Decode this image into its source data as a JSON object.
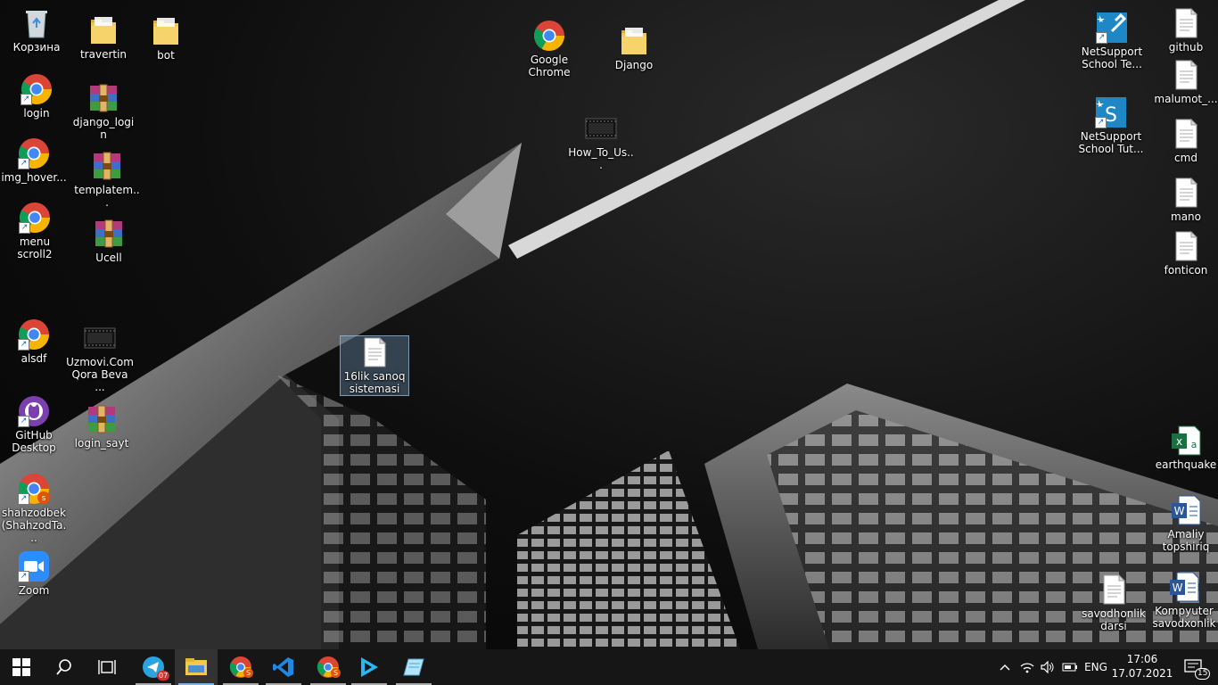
{
  "desktop": {
    "left_icons": [
      {
        "label": "Корзина",
        "icon": "recycle-bin"
      },
      {
        "label": "login",
        "icon": "chrome"
      },
      {
        "label": "img_hover...",
        "icon": "chrome"
      },
      {
        "label": "menu scroll2",
        "icon": "chrome"
      },
      {
        "label": "alsdf",
        "icon": "chrome"
      },
      {
        "label": "GitHub Desktop",
        "icon": "github-desktop"
      },
      {
        "label": "shahzodbek (ShahzodTa...",
        "icon": "chrome-profile"
      },
      {
        "label": "Zoom",
        "icon": "zoom"
      }
    ],
    "col2_icons": [
      {
        "label": "travertin",
        "icon": "folder"
      },
      {
        "label": "django_login",
        "icon": "winrar-archive"
      },
      {
        "label": "templatem...",
        "icon": "winrar-archive"
      },
      {
        "label": "Ucell",
        "icon": "winrar-archive"
      },
      {
        "label": "Uzmovi.Com Qora Beva ...",
        "icon": "video"
      },
      {
        "label": "login_sayt",
        "icon": "winrar-archive"
      }
    ],
    "col3_icons": [
      {
        "label": "bot",
        "icon": "folder"
      }
    ],
    "middle_icons": [
      {
        "label": "Google Chrome",
        "icon": "chrome"
      },
      {
        "label": "Django",
        "icon": "folder"
      },
      {
        "label": "How_To_Us...",
        "icon": "video"
      },
      {
        "label": "16lik sanoq sistemasi",
        "icon": "text-file",
        "selected": true
      }
    ],
    "right_icons": [
      {
        "label": "NetSupport School Te...",
        "icon": "netsupport-tech"
      },
      {
        "label": "NetSupport School Tut...",
        "icon": "netsupport-tutor"
      },
      {
        "label": "github",
        "icon": "text-file"
      },
      {
        "label": "malumot_...",
        "icon": "text-file"
      },
      {
        "label": "cmd",
        "icon": "text-file"
      },
      {
        "label": "mano",
        "icon": "text-file"
      },
      {
        "label": "fonticon",
        "icon": "text-file"
      },
      {
        "label": "earthquake",
        "icon": "excel"
      },
      {
        "label": "Amaliy topshiriq",
        "icon": "word"
      },
      {
        "label": "savodhonlik darsi",
        "icon": "text-file"
      },
      {
        "label": "Kompyuter savodxonlik",
        "icon": "word"
      }
    ]
  },
  "taskbar": {
    "apps": [
      {
        "name": "start",
        "icon": "windows-logo-icon"
      },
      {
        "name": "search",
        "icon": "search-icon"
      },
      {
        "name": "task-view",
        "icon": "task-view-icon"
      },
      {
        "name": "telegram",
        "icon": "telegram-icon",
        "badge": "07"
      },
      {
        "name": "file-explorer",
        "icon": "folder-icon",
        "active": true
      },
      {
        "name": "chrome-profile-1",
        "icon": "chrome-icon",
        "badge": "S"
      },
      {
        "name": "vscode",
        "icon": "vscode-icon"
      },
      {
        "name": "chrome-profile-2",
        "icon": "chrome-icon",
        "badge": "S"
      },
      {
        "name": "media-player",
        "icon": "play-icon"
      },
      {
        "name": "notepad",
        "icon": "notepad-icon"
      }
    ],
    "tray": {
      "language": "ENG",
      "time": "17:06",
      "date": "17.07.2021",
      "notification_count": "15"
    }
  },
  "colors": {
    "taskbar_bg": "#161616",
    "active_indicator": "#7fb3e8",
    "chrome_red": "#db4437",
    "chrome_green": "#0f9d58",
    "chrome_yellow": "#f4b400",
    "chrome_blue": "#4285f4",
    "folder_yellow": "#f2c94c"
  }
}
